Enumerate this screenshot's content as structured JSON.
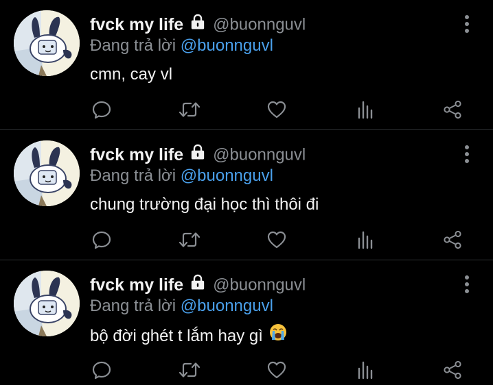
{
  "colors": {
    "background": "#000000",
    "text_primary": "#f2f2f2",
    "text_secondary": "#8b8f94",
    "link": "#4aa0ec",
    "divider": "#2f3336",
    "icon": "#8b8f94"
  },
  "tweets": [
    {
      "display_name": "fvck my life",
      "handle": "@buonnguvl",
      "reply_prefix": "Đang trả lời",
      "reply_to": "@buonnguvl",
      "text": "cmn, cay vl",
      "has_emoji": false
    },
    {
      "display_name": "fvck my life",
      "handle": "@buonnguvl",
      "reply_prefix": "Đang trả lời",
      "reply_to": "@buonnguvl",
      "text": "chung trường đại học thì thôi đi",
      "has_emoji": false
    },
    {
      "display_name": "fvck my life",
      "handle": "@buonnguvl",
      "reply_prefix": "Đang trả lời",
      "reply_to": "@buonnguvl",
      "text": "bộ đời ghét t lắm hay gì",
      "has_emoji": true,
      "emoji": "loudly-crying-face"
    }
  ],
  "icons": {
    "protected": "lock-icon",
    "more": "more-options-icon",
    "actions": [
      "reply-icon",
      "retweet-icon",
      "like-icon",
      "views-icon",
      "share-icon"
    ]
  }
}
